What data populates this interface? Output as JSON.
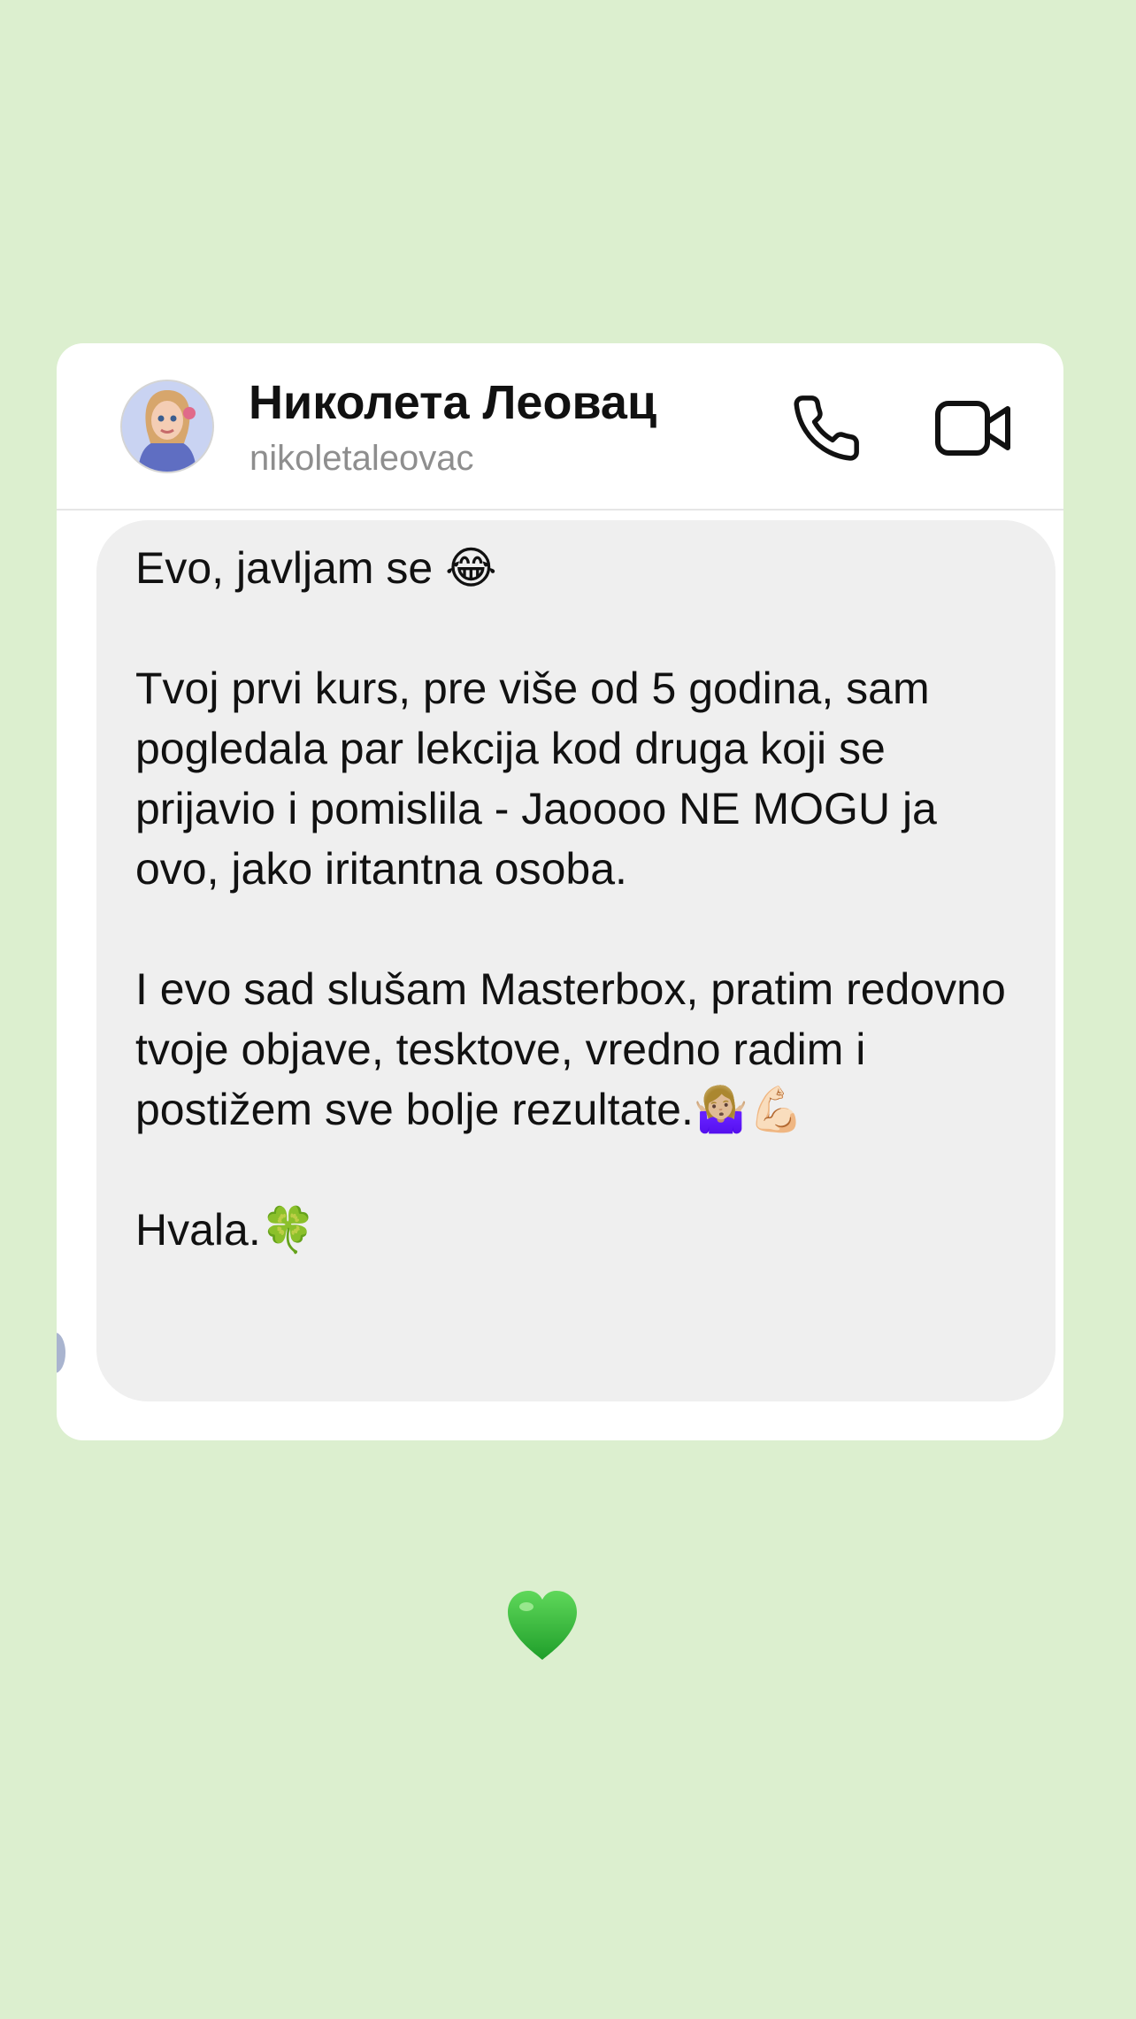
{
  "contact": {
    "name": "Николета Леовац",
    "username": "nikoletaleovac",
    "avatar_icon": "avatar-photo"
  },
  "actions": {
    "call_icon": "phone-icon",
    "video_icon": "video-camera-icon"
  },
  "message": {
    "paragraphs": [
      "Evo, javljam se 😂",
      "Tvoj prvi kurs, pre više od 5 godina, sam pogledala par lekcija kod druga koji se prijavio i pomislila - Jaoooo NE MOGU ja ovo, jako iritantna osoba.",
      "I evo sad slušam Masterbox, pratim redovno tvoje objave, tesktove, vredno radim i postižem sve bolje rezultate.🤷🏼‍♀️💪🏻",
      "Hvala.🍀"
    ]
  },
  "decoration": {
    "heart_icon": "green-heart-icon",
    "heart_color": "#2fb52f"
  },
  "colors": {
    "background": "#dcefcf",
    "card": "#ffffff",
    "bubble": "#efefef"
  }
}
